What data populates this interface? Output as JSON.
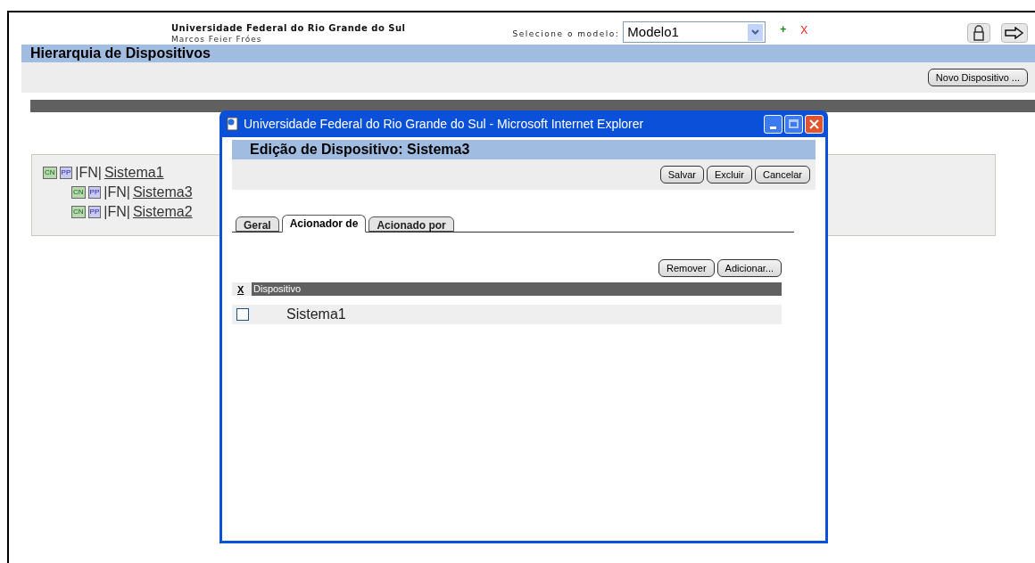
{
  "header": {
    "organization": "Universidade Federal do Rio Grande do Sul",
    "user": "Marcos Feier Fróes",
    "model_label": "Selecione o modelo:",
    "model_value": "Modelo1",
    "add": "+",
    "remove": "X"
  },
  "page_title": "Hierarquia de Dispositivos",
  "new_button": "Novo Dispositivo ...",
  "tree": [
    {
      "tag1": "CN",
      "tag2": "PP",
      "type": "|FN|",
      "name": "Sistema1",
      "children": [
        {
          "tag1": "CN",
          "tag2": "PP",
          "type": "|FN|",
          "name": "Sistema3"
        },
        {
          "tag1": "CN",
          "tag2": "PP",
          "type": "|FN|",
          "name": "Sistema2"
        }
      ]
    }
  ],
  "dialog": {
    "window_title": "Universidade Federal do Rio Grande do Sul - Microsoft Internet Explorer",
    "heading": "Edição de Dispositivo: Sistema3",
    "actions": [
      "Salvar",
      "Excluir",
      "Cancelar"
    ],
    "tabs": [
      {
        "label": "Geral",
        "selected": false
      },
      {
        "label": "Acionador de",
        "selected": true
      },
      {
        "label": "Acionado por",
        "selected": false
      }
    ],
    "list_actions": [
      "Remover",
      "Adicionar..."
    ],
    "columns": [
      "X",
      "Dispositivo"
    ],
    "rows": [
      {
        "name": "Sistema1",
        "checked": false
      }
    ]
  }
}
